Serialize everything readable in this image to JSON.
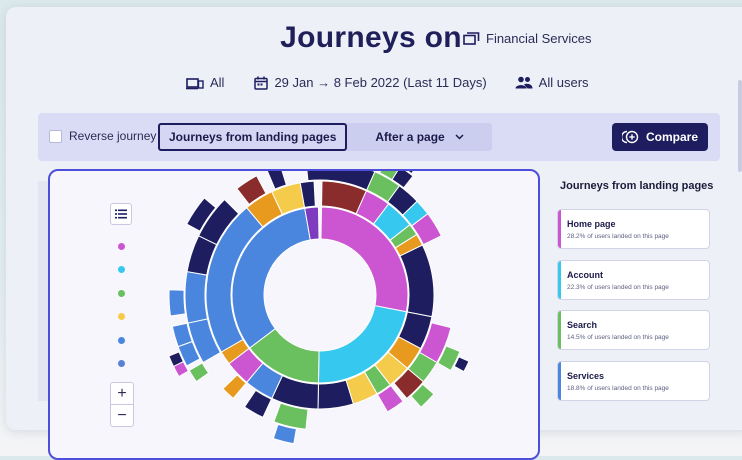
{
  "header": {
    "title": "Journeys on",
    "workspace": "Financial Services",
    "filters": {
      "device": "All",
      "date_range": "29 Jan → 8 Feb 2022 (Last 11 Days)",
      "users": "All users"
    }
  },
  "toolbar": {
    "reverse_label": "Reverse journey",
    "reverse_checked": false,
    "modes": [
      "Journeys from landing pages",
      "After a page"
    ],
    "active_mode": "Journeys from landing pages",
    "compare_label": "Compare"
  },
  "legend_dots": [
    {
      "color": "#cc55d1"
    },
    {
      "color": "#37c8ef"
    },
    {
      "color": "#6abf5f"
    },
    {
      "color": "#f5cb4b"
    },
    {
      "color": "#4a86de"
    },
    {
      "color": "#5a7fd6"
    }
  ],
  "zoom": {
    "in": "+",
    "out": "−"
  },
  "landing_pages": {
    "title": "Journeys from landing pages",
    "items": [
      {
        "name": "Home page",
        "stat": "28.2% of users landed on this page",
        "percent": 28.2,
        "color": "#cc55d1"
      },
      {
        "name": "Account",
        "stat": "22.3% of users landed on this page",
        "percent": 22.3,
        "color": "#37c8ef"
      },
      {
        "name": "Search",
        "stat": "14.5% of users landed on this page",
        "percent": 14.5,
        "color": "#6abf5f"
      },
      {
        "name": "Services",
        "stat": "18.8% of users landed on this page",
        "percent": 18.8,
        "color": "#4a86de"
      }
    ]
  },
  "colors": {
    "navy": "#1d1d60",
    "accent_border": "#4d4ed9",
    "home": "#cc55d1",
    "account": "#37c8ef",
    "search": "#6abf5f",
    "services": "#4a86de",
    "yellow": "#f5cb4b",
    "orange": "#e79a1e",
    "maroon": "#8a2c2c"
  }
}
